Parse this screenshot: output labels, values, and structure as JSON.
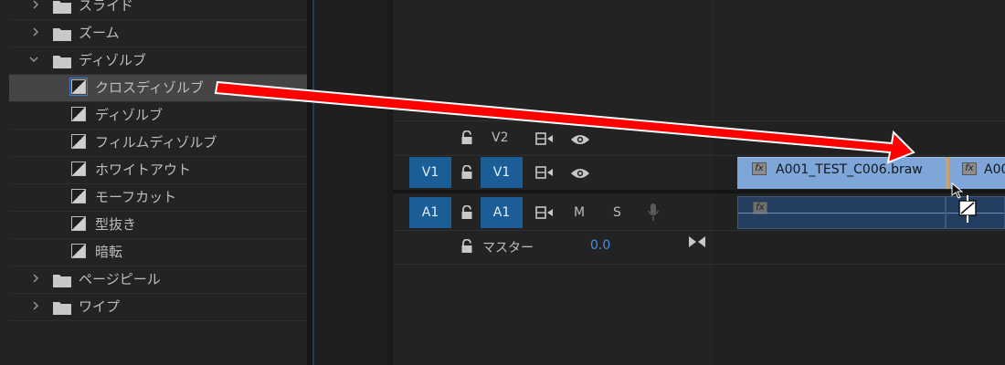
{
  "effects_panel": {
    "items": [
      {
        "type": "folder",
        "expanded": false,
        "label": "スライド"
      },
      {
        "type": "folder",
        "expanded": false,
        "label": "ズーム"
      },
      {
        "type": "folder",
        "expanded": true,
        "label": "ディゾルブ"
      },
      {
        "type": "effect",
        "selected": true,
        "label": "クロスディゾルブ"
      },
      {
        "type": "effect",
        "label": "ディゾルブ"
      },
      {
        "type": "effect",
        "label": "フィルムディゾルブ"
      },
      {
        "type": "effect",
        "label": "ホワイトアウト"
      },
      {
        "type": "effect",
        "label": "モーフカット"
      },
      {
        "type": "effect",
        "label": "型抜き"
      },
      {
        "type": "effect",
        "label": "暗転"
      },
      {
        "type": "folder",
        "expanded": false,
        "label": "ページピール"
      },
      {
        "type": "folder",
        "expanded": false,
        "label": "ワイプ"
      }
    ]
  },
  "timeline": {
    "tracks": {
      "v2": {
        "target_label": "V2"
      },
      "v1": {
        "source_label": "V1",
        "target_label": "V1"
      },
      "a1": {
        "source_label": "A1",
        "target_label": "A1",
        "mute_label": "M",
        "solo_label": "S"
      },
      "master": {
        "label": "マスター",
        "value": "0.0"
      }
    },
    "clips": {
      "video": [
        {
          "name": "A001_TEST_C006.braw",
          "fx": "fx"
        },
        {
          "name": "A00",
          "fx": "fx"
        }
      ],
      "audio": [
        {
          "fx": "fx"
        }
      ]
    }
  },
  "annotation": {
    "color": "#ff0000"
  },
  "colors": {
    "track_target_active": "#1b5e97",
    "video_clip": "#7fa6d8",
    "audio_clip": "#233e60"
  }
}
